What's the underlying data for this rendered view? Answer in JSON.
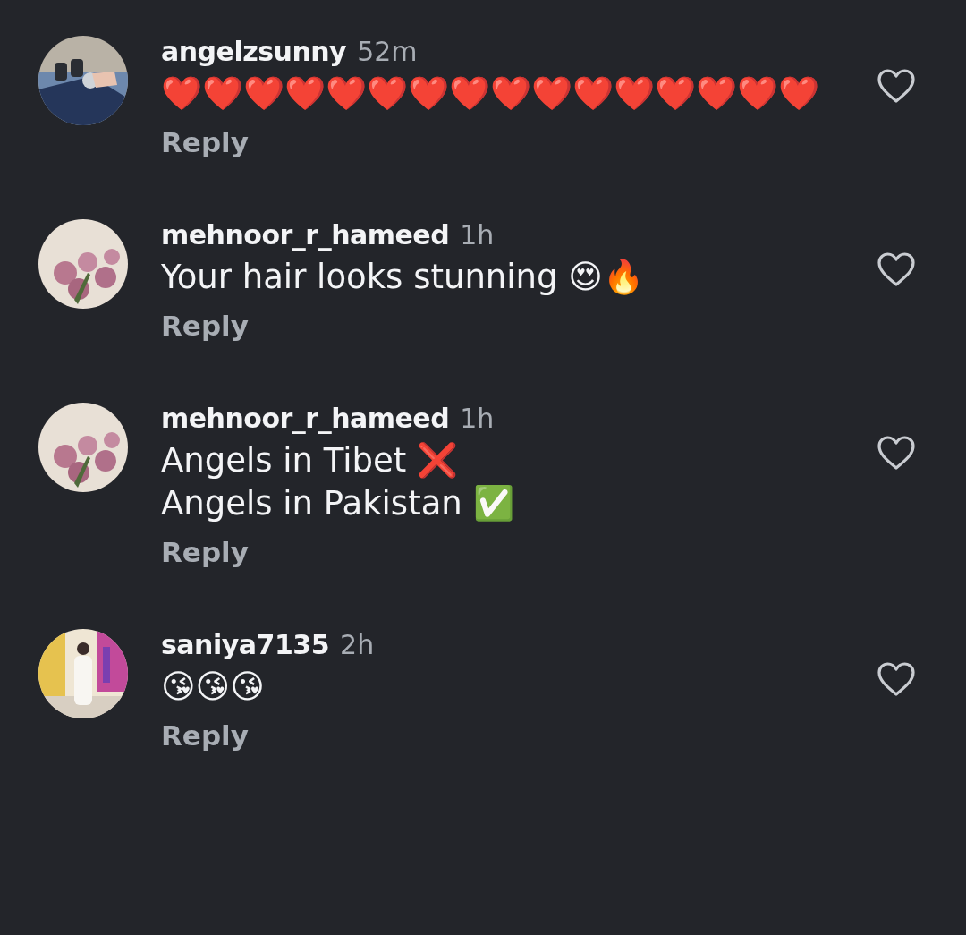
{
  "comments": [
    {
      "username": "angelzsunny",
      "time": "52m",
      "lines": [
        "❤️❤️❤️❤️❤️❤️❤️❤️❤️❤️❤️❤️❤️❤️❤️❤️"
      ],
      "reply": "Reply",
      "liked": false
    },
    {
      "username": "mehnoor_r_hameed",
      "time": "1h",
      "lines": [
        "Your hair looks stunning 😍🔥"
      ],
      "reply": "Reply",
      "liked": false
    },
    {
      "username": "mehnoor_r_hameed",
      "time": "1h",
      "lines": [
        "Angels in Tibet ❌",
        "Angels in Pakistan ✅"
      ],
      "reply": "Reply",
      "liked": false
    },
    {
      "username": "saniya7135",
      "time": "2h",
      "lines": [
        "😘😘😘"
      ],
      "reply": "Reply",
      "liked": false
    }
  ]
}
